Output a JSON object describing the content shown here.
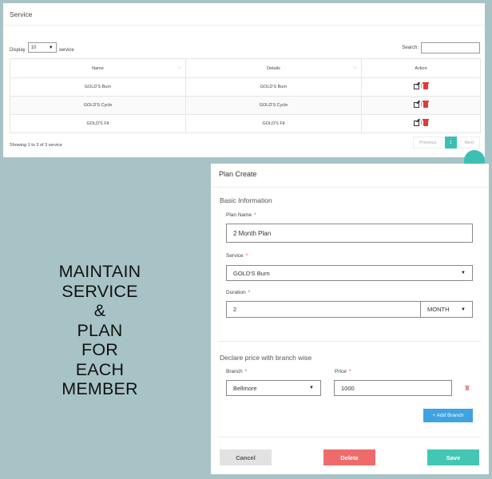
{
  "service": {
    "title": "Service",
    "display_label": "Display",
    "display_value": "10",
    "display_suffix": "service",
    "search_label": "Search:",
    "columns": [
      "Name",
      "Details",
      "Action"
    ],
    "rows": [
      {
        "name": "GOLD'S Burn",
        "details": "GOLD'S Burn"
      },
      {
        "name": "GOLD'S Cycle",
        "details": "GOLD'S Cycle"
      },
      {
        "name": "GOLD'S Fit",
        "details": "GOLD'S Fit"
      }
    ],
    "footer": "Showing 1 to 3 of 3 service",
    "pager": {
      "prev": "Previous",
      "page": "1",
      "next": "Next"
    }
  },
  "headline": [
    "MAINTAIN",
    "SERVICE",
    "&",
    "PLAN",
    "FOR",
    "EACH",
    "MEMBER"
  ],
  "plan": {
    "title": "Plan Create",
    "basic_title": "Basic Information",
    "plan_name_label": "Plan Name",
    "plan_name_value": "2 Month Plan",
    "service_label": "Service",
    "service_value": "GOLD'S Burn",
    "duration_label": "Duration",
    "duration_value": "2",
    "duration_unit": "MONTH",
    "price_title": "Declare price with branch wise",
    "branch_label": "Branch",
    "branch_value": "Bellmore",
    "price_label": "Price",
    "price_value": "1000",
    "required_mark": "*",
    "add_branch": "+ Add Branch",
    "cancel": "Cancel",
    "delete": "Delete",
    "save": "Save"
  },
  "colors": {
    "background": "#a8c3c6",
    "teal": "#3cbfb3",
    "blue": "#3ea3e0",
    "red": "#ef6b6b"
  }
}
